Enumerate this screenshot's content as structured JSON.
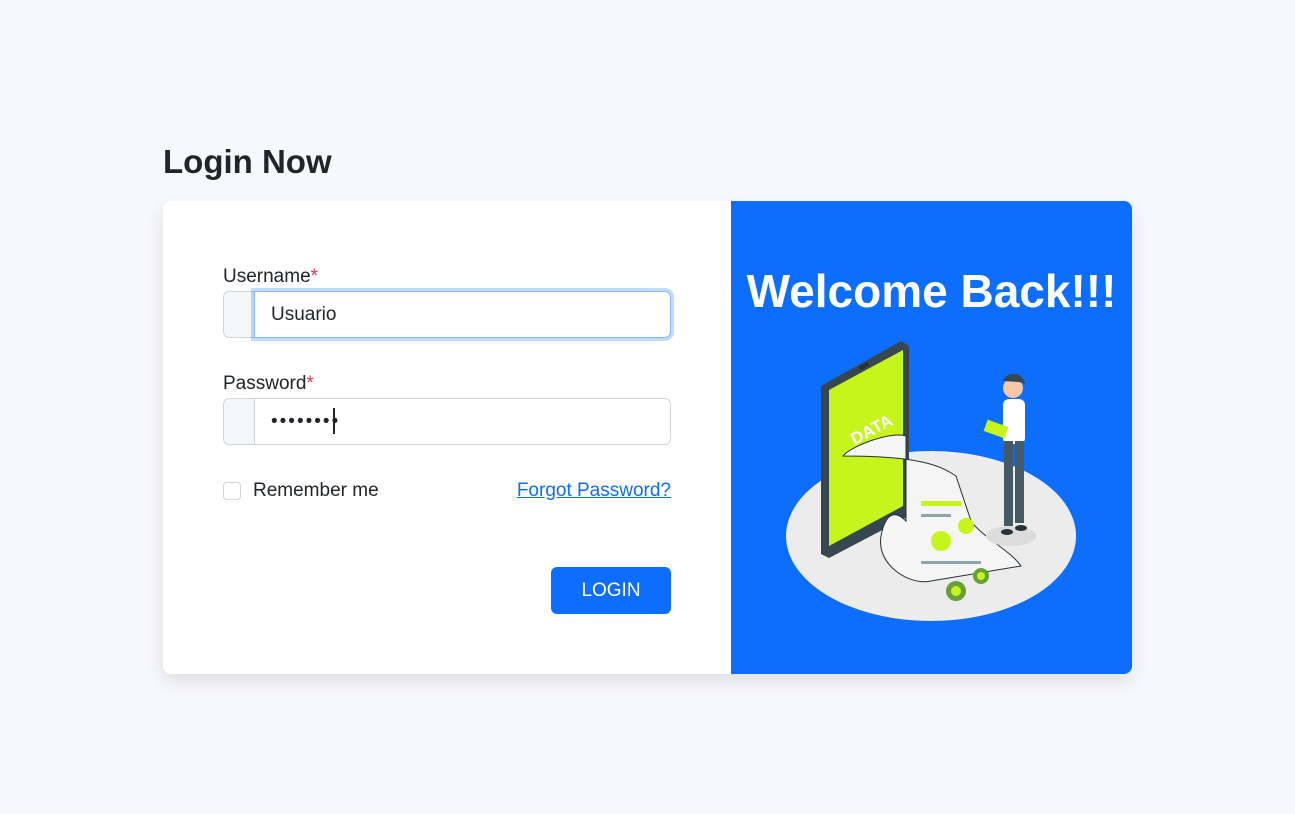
{
  "page": {
    "title": "Login Now"
  },
  "form": {
    "username": {
      "label": "Username",
      "required_mark": "*",
      "value": "Usuario"
    },
    "password": {
      "label": "Password",
      "required_mark": "*",
      "value": "••••••••"
    },
    "remember_label": "Remember me",
    "forgot_link": "Forgot Password?",
    "login_button": "LOGIN"
  },
  "hero": {
    "heading": "Welcome Back!!!",
    "illustration_text": "DATA",
    "accent_color": "#0d6efd",
    "highlight_color": "#c6f51c"
  }
}
